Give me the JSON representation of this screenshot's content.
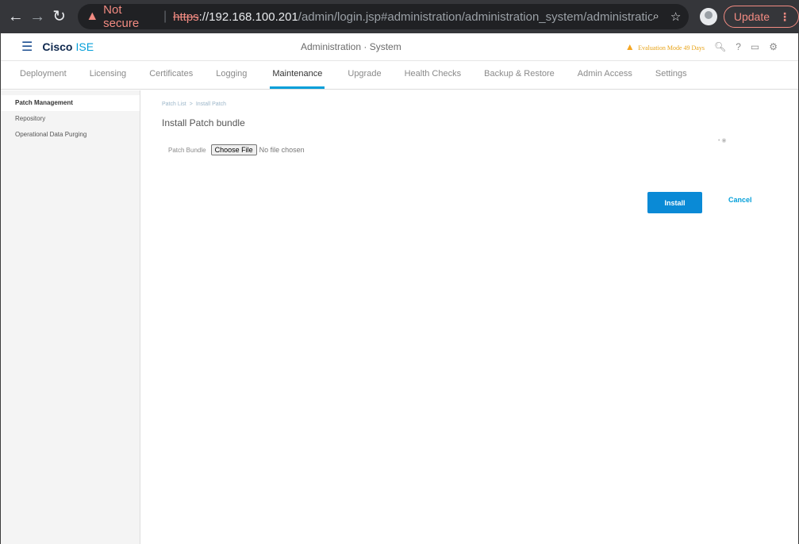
{
  "browser": {
    "warning_label": "Not secure",
    "url_scheme": "https",
    "url_host": "://192.168.100.201",
    "url_path": "/admin/login.jsp#administration/administration_system/administration_...",
    "update_label": "Update"
  },
  "header": {
    "brand": "Cisco",
    "brand_sub": "ISE",
    "title": "Administration · System",
    "evaluation": "Evaluation Mode 49 Days"
  },
  "tabs": [
    {
      "label": "Deployment"
    },
    {
      "label": "Licensing"
    },
    {
      "label": "Certificates"
    },
    {
      "label": "Logging"
    },
    {
      "label": "Maintenance"
    },
    {
      "label": "Upgrade"
    },
    {
      "label": "Health Checks"
    },
    {
      "label": "Backup & Restore"
    },
    {
      "label": "Admin Access"
    },
    {
      "label": "Settings"
    }
  ],
  "sidebar": {
    "items": [
      {
        "label": "Patch Management"
      },
      {
        "label": "Repository"
      },
      {
        "label": "Operational Data Purging"
      }
    ]
  },
  "main": {
    "breadcrumb_parent": "Patch List",
    "breadcrumb_current": "Install Patch",
    "title": "Install Patch bundle",
    "field_label": "Patch Bundle",
    "choose_file": "Choose File",
    "file_status": "No file chosen",
    "install": "Install",
    "cancel": "Cancel"
  }
}
